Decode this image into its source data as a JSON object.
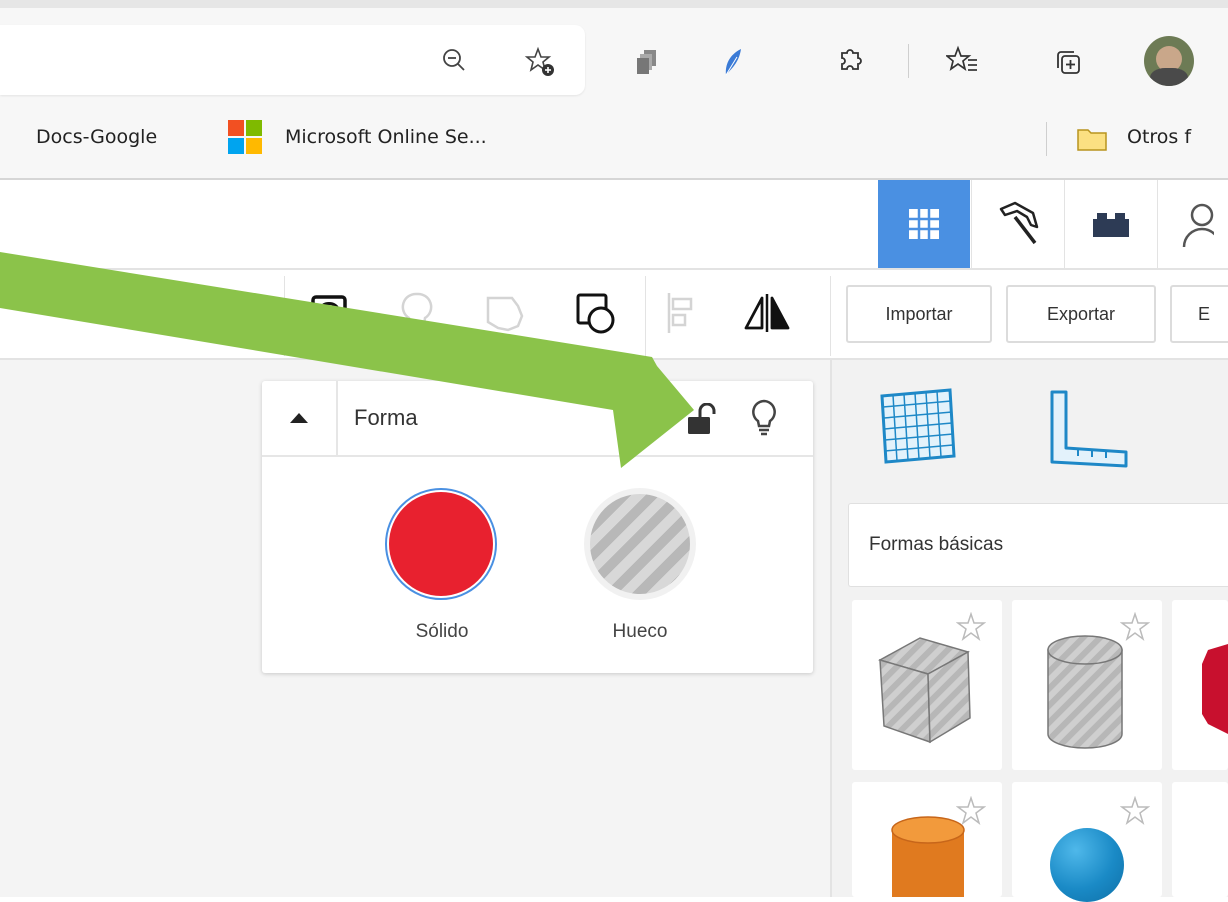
{
  "browser": {
    "toolbar_icons": [
      "zoom-out-icon",
      "add-favorite-icon",
      "extension-icon",
      "feather-extension-icon",
      "extensions-puzzle-icon",
      "favorites-icon",
      "collections-icon",
      "profile-avatar"
    ],
    "bookmarks": [
      {
        "label": "Docs-Google"
      },
      {
        "label": "Microsoft Online Se...",
        "icon": "microsoft-logo-icon"
      }
    ],
    "other_favorites": {
      "label": "Otros f",
      "icon": "folder-icon"
    }
  },
  "app": {
    "view_modes": [
      "3d-design-grid-icon",
      "minecraft-pickaxe-icon",
      "lego-brick-icon",
      "profile-icon"
    ],
    "tools": [
      "show-all-icon",
      "hint-bulb-icon",
      "group-icon",
      "ungroup-icon",
      "align-icon",
      "mirror-icon"
    ],
    "actions": {
      "import": "Importar",
      "export": "Exportar",
      "send": "E"
    },
    "accent_color": "#4a90e2"
  },
  "inspector": {
    "title": "Forma",
    "options": [
      {
        "label": "Sólido",
        "color": "#e8212f",
        "selected": true
      },
      {
        "label": "Hueco",
        "pattern": "striped-gray",
        "selected": false
      }
    ]
  },
  "shapes_panel": {
    "view_icons": [
      "workplane-grid-icon",
      "ruler-icon"
    ],
    "category": "Formas básicas",
    "shapes": [
      {
        "name": "box",
        "color": "#a9a9a9"
      },
      {
        "name": "cylinder",
        "color": "#a9a9a9"
      },
      {
        "name": "box-red",
        "color": "#c8102e"
      },
      {
        "name": "cylinder-orange",
        "color": "#e67e22"
      },
      {
        "name": "sphere",
        "color": "#1a8ac6"
      }
    ]
  },
  "annotation": {
    "color": "#8bc34a",
    "target": "lock-icon"
  }
}
